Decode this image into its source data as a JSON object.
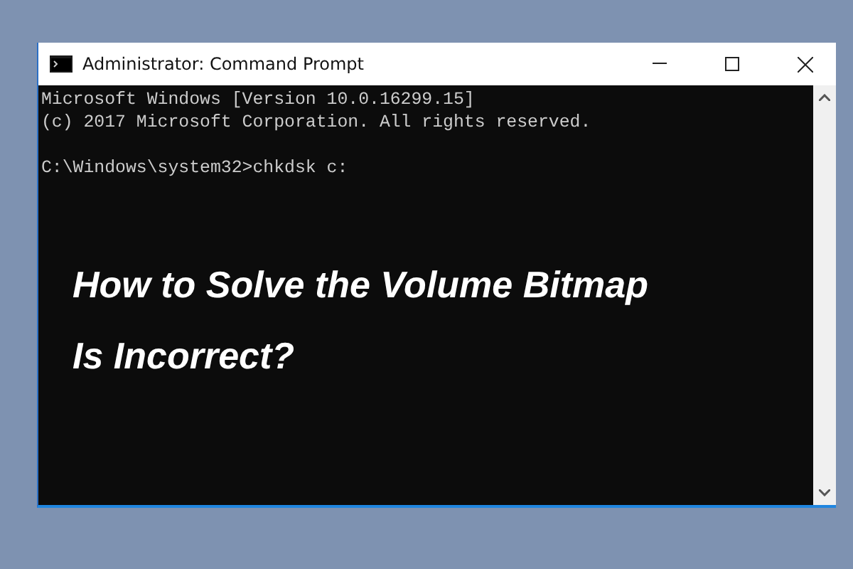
{
  "window": {
    "title": "Administrator: Command Prompt"
  },
  "console": {
    "blocks": [
      [
        "Microsoft Windows [Version 10.0.16299.15]",
        "(c) 2017 Microsoft Corporation. All rights reserved."
      ],
      [
        "C:\\Windows\\system32>chkdsk c:"
      ]
    ]
  },
  "headline": {
    "lines": [
      "How to Solve the Volume Bitmap",
      "Is Incorrect?"
    ]
  }
}
